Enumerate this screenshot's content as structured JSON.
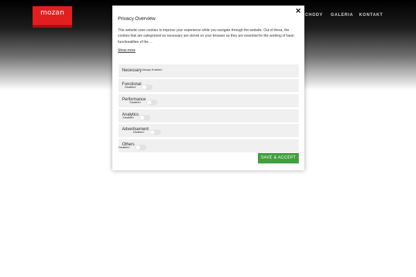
{
  "site": {
    "logo_text": "mozan",
    "brand_color": "#e11f1f",
    "nav": [
      "CHODY",
      "GALERIA",
      "KONTAKT"
    ]
  },
  "modal": {
    "close_label": "✕",
    "title": "Privacy Overview",
    "description": "This website uses cookies to improve your experience while you navigate through the website. Out of these, the cookies that are categorized as necessary are stored on your browser as they are essential for the working of basic functionalities of the ...",
    "show_more": "Show more",
    "categories": [
      {
        "label": "Necessary",
        "status": "Always Enabled"
      },
      {
        "label": "Functional",
        "status": "Disabled"
      },
      {
        "label": "Performance",
        "status": "Disabled"
      },
      {
        "label": "Analytics",
        "status": "Disabled"
      },
      {
        "label": "Advertisement",
        "status": "Disabled"
      },
      {
        "label": "Others",
        "status": "Disabled"
      }
    ],
    "save_label": "SAVE & ACCEPT",
    "save_color": "#3f9f3f"
  }
}
